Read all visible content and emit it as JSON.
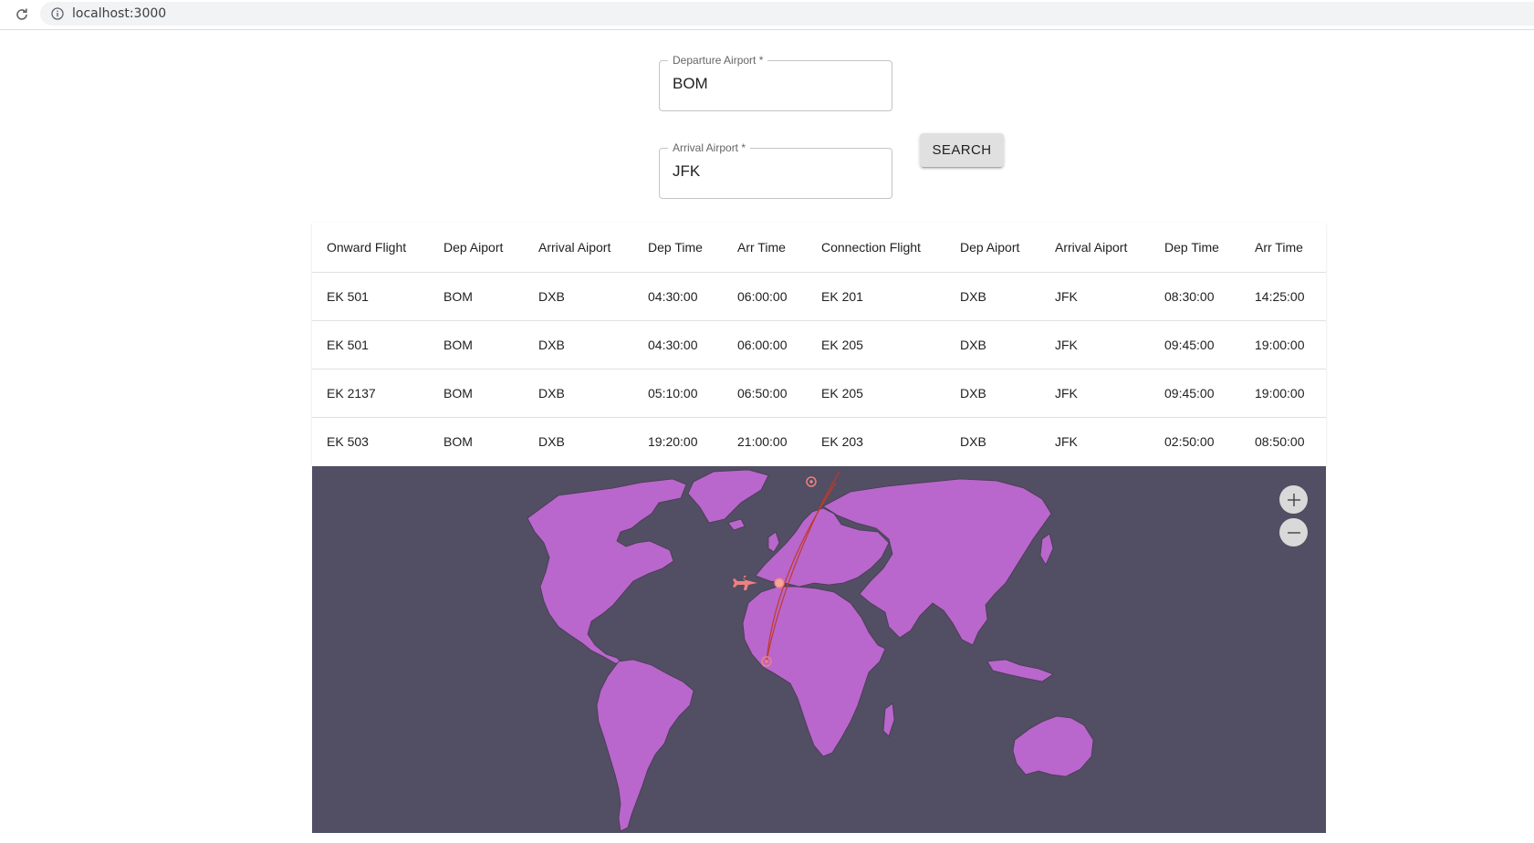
{
  "browser": {
    "url": "localhost:3000",
    "reload_icon": "reload-icon",
    "info_icon": "info-icon"
  },
  "form": {
    "departure": {
      "label": "Departure Airport *",
      "value": "BOM"
    },
    "arrival": {
      "label": "Arrival Airport *",
      "value": "JFK"
    },
    "search_label": "SEARCH"
  },
  "table": {
    "headers": [
      "Onward Flight",
      "Dep Aiport",
      "Arrival Aiport",
      "Dep Time",
      "Arr Time",
      "Connection Flight",
      "Dep Aiport",
      "Arrival Aiport",
      "Dep Time",
      "Arr Time"
    ],
    "rows": [
      [
        "EK 501",
        "BOM",
        "DXB",
        "04:30:00",
        "06:00:00",
        "EK 201",
        "DXB",
        "JFK",
        "08:30:00",
        "14:25:00"
      ],
      [
        "EK 501",
        "BOM",
        "DXB",
        "04:30:00",
        "06:00:00",
        "EK 205",
        "DXB",
        "JFK",
        "09:45:00",
        "19:00:00"
      ],
      [
        "EK 2137",
        "BOM",
        "DXB",
        "05:10:00",
        "06:50:00",
        "EK 205",
        "DXB",
        "JFK",
        "09:45:00",
        "19:00:00"
      ],
      [
        "EK 503",
        "BOM",
        "DXB",
        "19:20:00",
        "21:00:00",
        "EK 203",
        "DXB",
        "JFK",
        "02:50:00",
        "08:50:00"
      ]
    ]
  },
  "map": {
    "ocean_color": "#524e63",
    "land_color": "#b967cc",
    "route_color": "#c0392b",
    "marker_color": "#f08080",
    "zoom_in_icon": "plus-icon",
    "zoom_out_icon": "minus-icon",
    "plane_icon": "airplane-icon"
  }
}
